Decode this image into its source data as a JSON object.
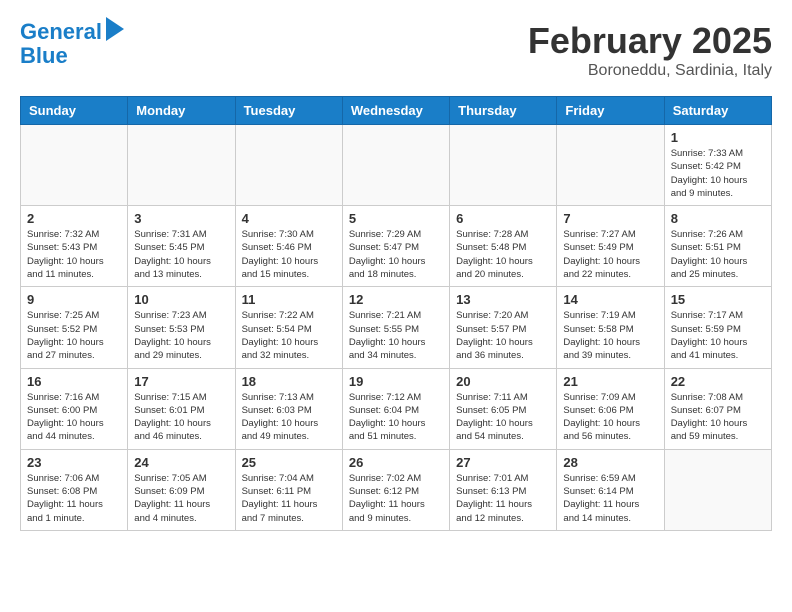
{
  "header": {
    "logo_line1": "General",
    "logo_line2": "Blue",
    "month": "February 2025",
    "location": "Boroneddu, Sardinia, Italy"
  },
  "weekdays": [
    "Sunday",
    "Monday",
    "Tuesday",
    "Wednesday",
    "Thursday",
    "Friday",
    "Saturday"
  ],
  "weeks": [
    [
      {
        "day": "",
        "info": ""
      },
      {
        "day": "",
        "info": ""
      },
      {
        "day": "",
        "info": ""
      },
      {
        "day": "",
        "info": ""
      },
      {
        "day": "",
        "info": ""
      },
      {
        "day": "",
        "info": ""
      },
      {
        "day": "1",
        "info": "Sunrise: 7:33 AM\nSunset: 5:42 PM\nDaylight: 10 hours\nand 9 minutes."
      }
    ],
    [
      {
        "day": "2",
        "info": "Sunrise: 7:32 AM\nSunset: 5:43 PM\nDaylight: 10 hours\nand 11 minutes."
      },
      {
        "day": "3",
        "info": "Sunrise: 7:31 AM\nSunset: 5:45 PM\nDaylight: 10 hours\nand 13 minutes."
      },
      {
        "day": "4",
        "info": "Sunrise: 7:30 AM\nSunset: 5:46 PM\nDaylight: 10 hours\nand 15 minutes."
      },
      {
        "day": "5",
        "info": "Sunrise: 7:29 AM\nSunset: 5:47 PM\nDaylight: 10 hours\nand 18 minutes."
      },
      {
        "day": "6",
        "info": "Sunrise: 7:28 AM\nSunset: 5:48 PM\nDaylight: 10 hours\nand 20 minutes."
      },
      {
        "day": "7",
        "info": "Sunrise: 7:27 AM\nSunset: 5:49 PM\nDaylight: 10 hours\nand 22 minutes."
      },
      {
        "day": "8",
        "info": "Sunrise: 7:26 AM\nSunset: 5:51 PM\nDaylight: 10 hours\nand 25 minutes."
      }
    ],
    [
      {
        "day": "9",
        "info": "Sunrise: 7:25 AM\nSunset: 5:52 PM\nDaylight: 10 hours\nand 27 minutes."
      },
      {
        "day": "10",
        "info": "Sunrise: 7:23 AM\nSunset: 5:53 PM\nDaylight: 10 hours\nand 29 minutes."
      },
      {
        "day": "11",
        "info": "Sunrise: 7:22 AM\nSunset: 5:54 PM\nDaylight: 10 hours\nand 32 minutes."
      },
      {
        "day": "12",
        "info": "Sunrise: 7:21 AM\nSunset: 5:55 PM\nDaylight: 10 hours\nand 34 minutes."
      },
      {
        "day": "13",
        "info": "Sunrise: 7:20 AM\nSunset: 5:57 PM\nDaylight: 10 hours\nand 36 minutes."
      },
      {
        "day": "14",
        "info": "Sunrise: 7:19 AM\nSunset: 5:58 PM\nDaylight: 10 hours\nand 39 minutes."
      },
      {
        "day": "15",
        "info": "Sunrise: 7:17 AM\nSunset: 5:59 PM\nDaylight: 10 hours\nand 41 minutes."
      }
    ],
    [
      {
        "day": "16",
        "info": "Sunrise: 7:16 AM\nSunset: 6:00 PM\nDaylight: 10 hours\nand 44 minutes."
      },
      {
        "day": "17",
        "info": "Sunrise: 7:15 AM\nSunset: 6:01 PM\nDaylight: 10 hours\nand 46 minutes."
      },
      {
        "day": "18",
        "info": "Sunrise: 7:13 AM\nSunset: 6:03 PM\nDaylight: 10 hours\nand 49 minutes."
      },
      {
        "day": "19",
        "info": "Sunrise: 7:12 AM\nSunset: 6:04 PM\nDaylight: 10 hours\nand 51 minutes."
      },
      {
        "day": "20",
        "info": "Sunrise: 7:11 AM\nSunset: 6:05 PM\nDaylight: 10 hours\nand 54 minutes."
      },
      {
        "day": "21",
        "info": "Sunrise: 7:09 AM\nSunset: 6:06 PM\nDaylight: 10 hours\nand 56 minutes."
      },
      {
        "day": "22",
        "info": "Sunrise: 7:08 AM\nSunset: 6:07 PM\nDaylight: 10 hours\nand 59 minutes."
      }
    ],
    [
      {
        "day": "23",
        "info": "Sunrise: 7:06 AM\nSunset: 6:08 PM\nDaylight: 11 hours\nand 1 minute."
      },
      {
        "day": "24",
        "info": "Sunrise: 7:05 AM\nSunset: 6:09 PM\nDaylight: 11 hours\nand 4 minutes."
      },
      {
        "day": "25",
        "info": "Sunrise: 7:04 AM\nSunset: 6:11 PM\nDaylight: 11 hours\nand 7 minutes."
      },
      {
        "day": "26",
        "info": "Sunrise: 7:02 AM\nSunset: 6:12 PM\nDaylight: 11 hours\nand 9 minutes."
      },
      {
        "day": "27",
        "info": "Sunrise: 7:01 AM\nSunset: 6:13 PM\nDaylight: 11 hours\nand 12 minutes."
      },
      {
        "day": "28",
        "info": "Sunrise: 6:59 AM\nSunset: 6:14 PM\nDaylight: 11 hours\nand 14 minutes."
      },
      {
        "day": "",
        "info": ""
      }
    ]
  ]
}
